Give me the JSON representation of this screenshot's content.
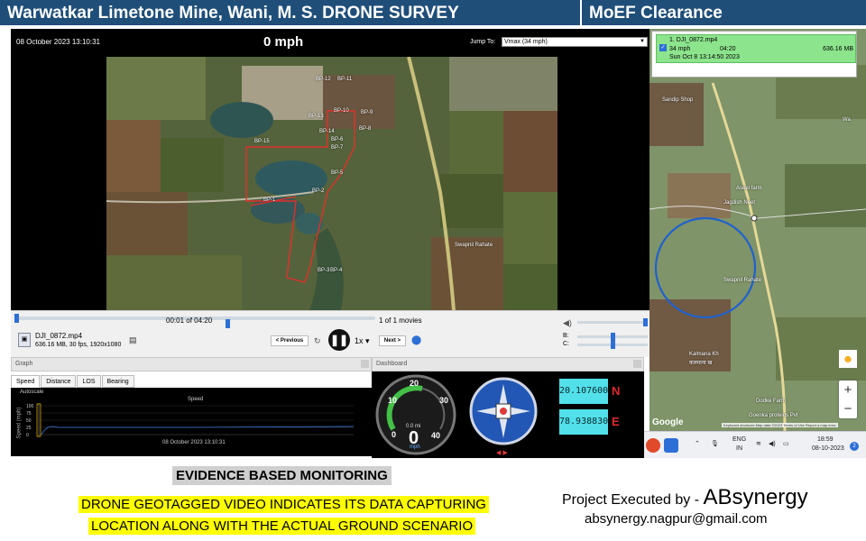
{
  "banner": {
    "title": "Warwatkar Limetone Mine, Wani, M. S.  DRONE SURVEY",
    "right": "MoEF Clearance"
  },
  "player": {
    "date": "08 October 2023 13:10:31",
    "speed": "0 mph",
    "jump_label": "Jump To:",
    "jump_value": "Vmax (34 mph)"
  },
  "sat_map": {
    "labels": [
      "BP-12",
      "BP-11",
      "BP-10",
      "BP-9",
      "BP-8",
      "BP-14",
      "BP-15",
      "BP-7",
      "BP-6",
      "BP-5",
      "BP-2",
      "BP-1",
      "BP-4",
      "BP-3",
      "Swapnil Rahate",
      "BP-13"
    ]
  },
  "controls": {
    "timecode": "00:01 of 04:20",
    "movie_count": "1 of 1 movies",
    "file_name": "DJI_0872.mp4",
    "file_meta": "636.16 MB, 30 fps, 1920x1080",
    "previous": "< Previous",
    "next": "Next >",
    "speed_mult": "1x",
    "b_label": "B:",
    "c_label": "C:"
  },
  "graph": {
    "header": "Graph",
    "tabs": [
      "Speed",
      "Distance",
      "LOS",
      "Bearing"
    ],
    "autoscale": "Autoscale",
    "title": "Speed",
    "ylabel": "Speed (mph)",
    "yticks": [
      "100",
      "75",
      "50",
      "25",
      "0"
    ],
    "date": "08 October 2023 13:10:31"
  },
  "dashboard": {
    "header": "Dashboard",
    "gauge_ticks": [
      "0",
      "10",
      "20",
      "30",
      "40"
    ],
    "gauge_value": "0",
    "gauge_sub": "0.0 mi",
    "gauge_unit": "mph",
    "lat": "20.107600",
    "lat_dir": "N",
    "lon": "78.938830",
    "lon_dir": "E"
  },
  "movie_list": {
    "name": "1. DJI_0872.mp4",
    "speed": "34 mph",
    "duration": "04:20",
    "size": "636.16 MB",
    "date": "Sun Oct 8 13:14:50 2023"
  },
  "right_map": {
    "labels": [
      "Sandip Shop",
      "Aseel farm",
      "Jagdish Neet",
      "Swapnil Rahate",
      "Kalmana Kh",
      "कलमाना ख",
      "Dodke Farm",
      "Goenka proteins Pvt",
      "Wa"
    ],
    "google": "Google",
    "attrib": "Keyboard shortcuts  Map data ©2023  Terms of Use  Report a map error"
  },
  "taskbar": {
    "lang": "ENG",
    "lang2": "IN",
    "time": "18:59",
    "date": "08-10-2023",
    "badge": "2"
  },
  "captions": {
    "heading": "EVIDENCE BASED MONITORING",
    "line1": "DRONE GEOTAGGED VIDEO INDICATES ITS DATA CAPTURING",
    "line2": "LOCATION ALONG WITH THE ACTUAL GROUND SCENARIO",
    "project_prefix": "Project Executed by - ",
    "company": "ABsynergy",
    "email": "absynergy.nagpur@gmail.com"
  }
}
